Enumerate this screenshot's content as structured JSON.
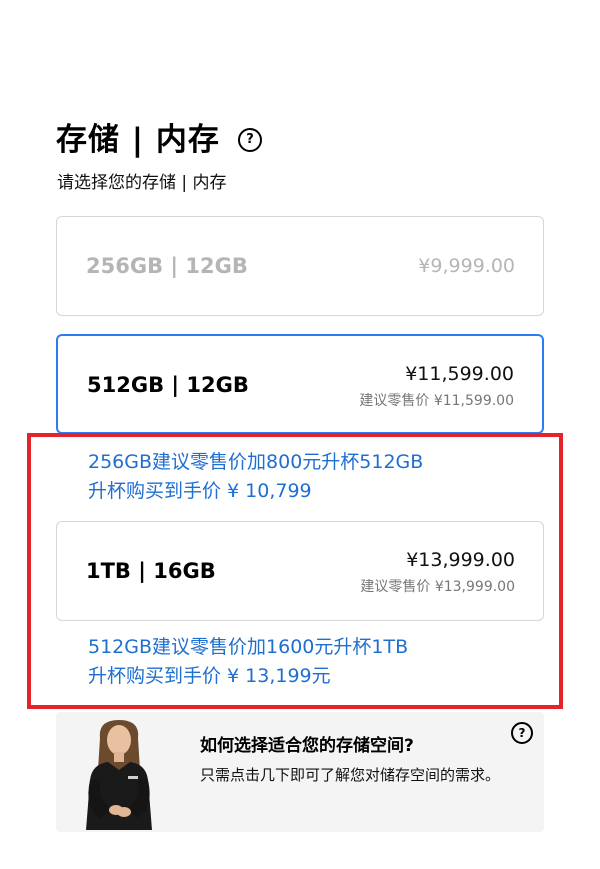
{
  "header": {
    "title": "存储 | 内存",
    "help_icon": "?",
    "subtitle": "请选择您的存储 | 内存"
  },
  "options": [
    {
      "label": "256GB | 12GB",
      "price": "¥9,999.00",
      "msrp": "",
      "state": "disabled"
    },
    {
      "label": "512GB | 12GB",
      "price": "¥11,599.00",
      "msrp": "建议零售价 ¥11,599.00",
      "state": "selected"
    },
    {
      "label": "1TB | 16GB",
      "price": "¥13,999.00",
      "msrp": "建议零售价 ¥13,999.00",
      "state": "available"
    }
  ],
  "promos": {
    "upgrade_512_line1": "256GB建议零售价加800元升杯512GB",
    "upgrade_512_line2": "升杯购买到手价 ¥ 10,799",
    "upgrade_1tb_line1": "512GB建议零售价加1600元升杯1TB",
    "upgrade_1tb_line2": "升杯购买到手价 ¥ 13,199元"
  },
  "helper": {
    "title": "如何选择适合您的存储空间?",
    "description": "只需点击几下即可了解您对储存空间的需求。",
    "help_icon": "?"
  },
  "colors": {
    "accent_blue": "#2d7cf6",
    "promo_text": "#1f6fd1",
    "highlight_red": "#e3242b",
    "disabled_text": "#b5b5b5"
  }
}
